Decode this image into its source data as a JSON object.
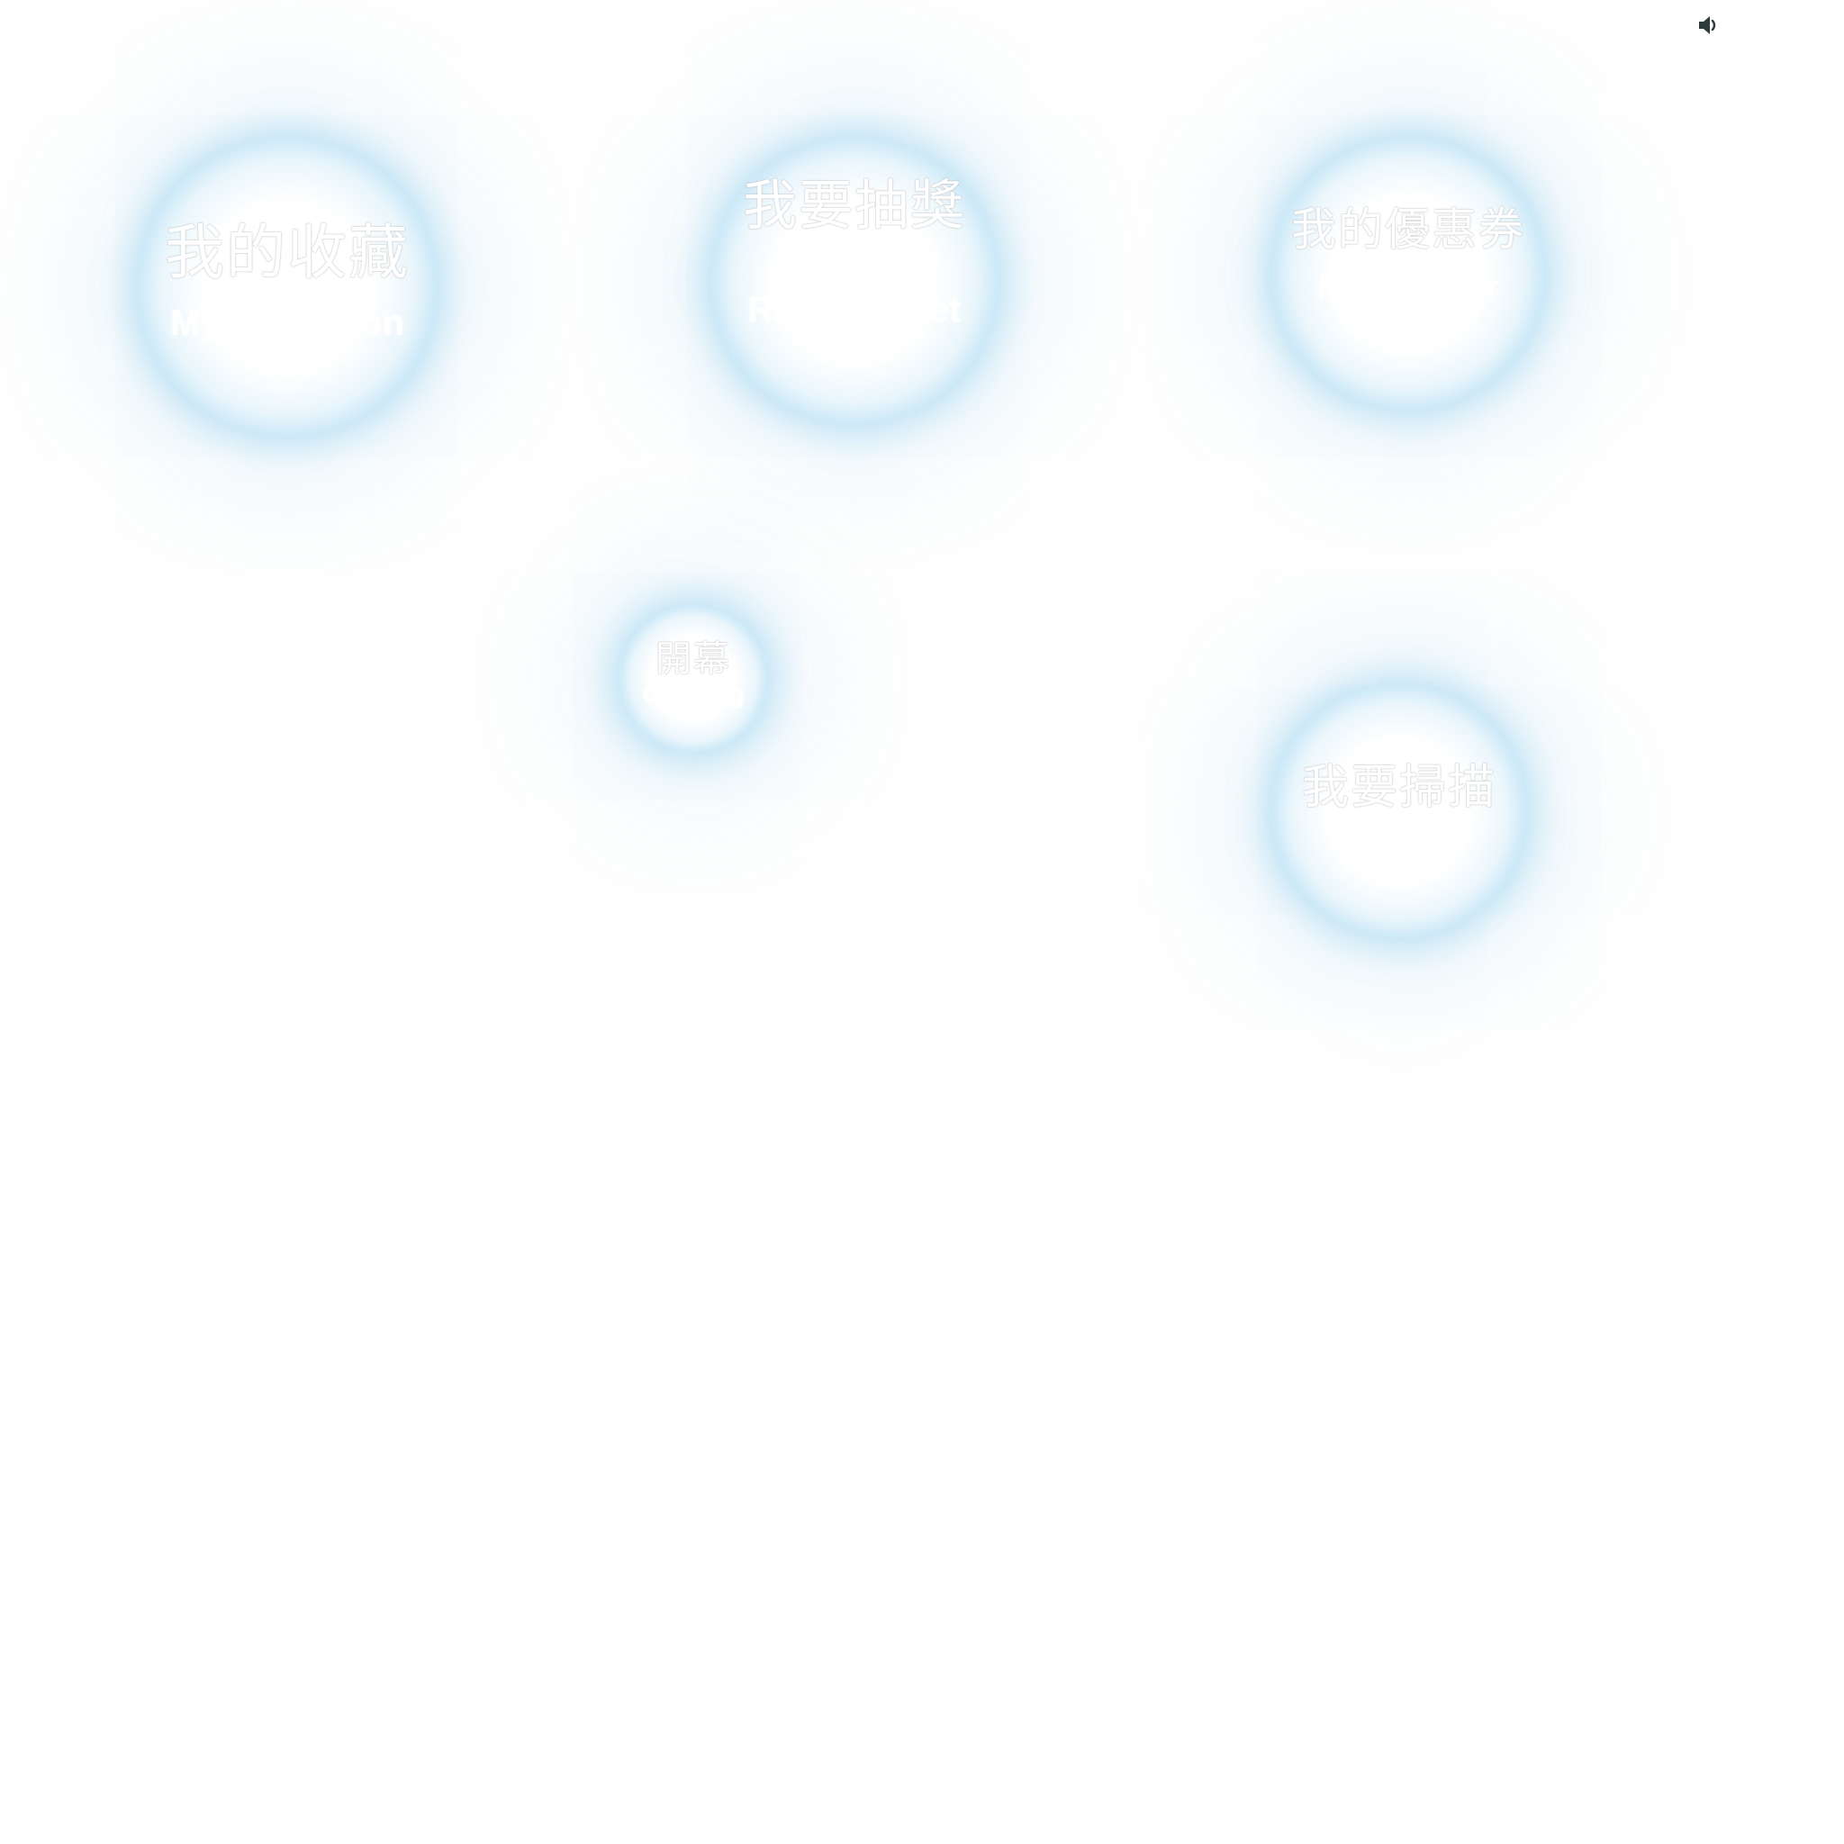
{
  "sound_toggle": {
    "icon": "speaker-icon",
    "color": "#2f3a3c"
  },
  "accent_color": "#5bb8e8",
  "bubbles": {
    "collection": {
      "zh": "我的收藏",
      "en": "My Collection"
    },
    "raffle": {
      "zh": "我要抽獎",
      "en": "Raffle Ticket"
    },
    "voucher": {
      "zh": "我的優惠券",
      "en": "My Voucher"
    },
    "opening": {
      "zh": "開幕",
      "en": "Opening"
    },
    "scan": {
      "zh": "我要掃描"
    }
  }
}
